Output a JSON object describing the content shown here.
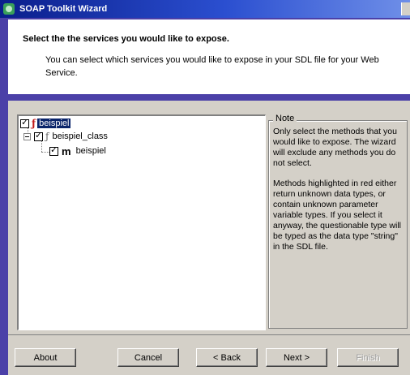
{
  "window": {
    "title": "SOAP Toolkit Wizard"
  },
  "header": {
    "heading": "Select the the services you would like to expose.",
    "description": "You can select which services you would like to expose in your SDL file for your Web Service."
  },
  "tree": {
    "items": [
      {
        "label": "beispiel",
        "checked": true,
        "selected": true,
        "icon": "service-icon",
        "color": "#c01818"
      },
      {
        "label": "beispiel_class",
        "checked": true,
        "selected": false,
        "icon": "class-icon"
      },
      {
        "label": "beispiel",
        "checked": true,
        "selected": false,
        "icon": "method-icon"
      }
    ]
  },
  "note": {
    "title": "Note",
    "para1": "Only select the methods that you would like to expose. The wizard will exclude any methods you do not select.",
    "para2": "Methods highlighted in red either return unknown data types, or contain unknown parameter variable types. If you select it anyway, the questionable type will be typed as the data type \"string\" in the SDL file."
  },
  "buttons": {
    "about": "About",
    "cancel": "Cancel",
    "back": "< Back",
    "next": "Next >",
    "finish": "Finish"
  }
}
